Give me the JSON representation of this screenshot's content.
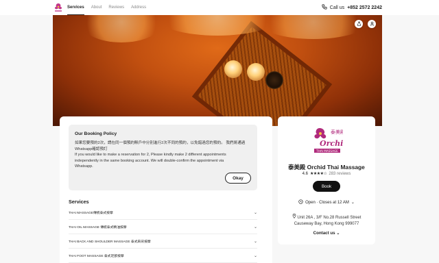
{
  "header": {
    "tabs": [
      {
        "label": "Services",
        "active": true
      },
      {
        "label": "About",
        "active": false
      },
      {
        "label": "Reviews",
        "active": false
      },
      {
        "label": "Address",
        "active": false
      }
    ],
    "call_label": "Call us",
    "phone": "+852 2572 2242",
    "icons": {
      "logo": "orchid-logo",
      "phone": "phone-icon"
    }
  },
  "hero": {
    "icons": {
      "share": "share-icon",
      "profile": "person-icon"
    }
  },
  "policy": {
    "title": "Our Booking Policy",
    "zh_line1": "如果您要預約2次，請在同一個預約賬戶中分別進行2次不同的預約，以免錯過您的預約。 我們將通過",
    "zh_line2": "Whatsapp確認預訂",
    "en_line1": "If you would like to make a reservation for 2, Please kindly make 2 different appointments",
    "en_line2": "independently in the same booking account. We will double-confirm the appointment via",
    "en_line3": "Whatsapp.",
    "okay_label": "Okay"
  },
  "services": {
    "title": "Services",
    "items": [
      "THAI MASSAGE傳統泰式按摩",
      "THAI OIL MASSAGE 傳統泰式精油按摩",
      "THAI BACK AND SHOULDER MASSAGE 泰式肩背按摩",
      "THAI FOOT MASSAGE 泰式足部按摩"
    ]
  },
  "business": {
    "name": "泰美殿 Orchid Thai Massage",
    "rating": "4.6",
    "stars": "★★★★☆",
    "reviews": "283 reviews",
    "book_label": "Book",
    "open_status": "Open · Closes at 12 AM",
    "address_line1": "Unit 26A , 3/F No.28 Russell Street",
    "address_line2": "Causeway Bay, Hong Kong 999077",
    "contact_label": "Contact us",
    "logo_text": "Orchid",
    "logo_subtext": "THAI MASSAGE"
  },
  "colors": {
    "accent": "#111111",
    "hero_glow": "#e06a18",
    "panel_bg": "#f0f0f0"
  }
}
